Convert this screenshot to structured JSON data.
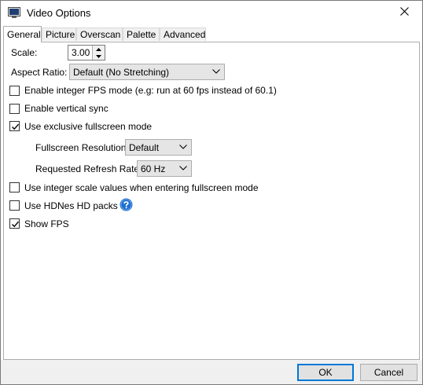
{
  "window": {
    "title": "Video Options",
    "app_icon": "monitor-icon",
    "close_icon": "close-icon"
  },
  "tabs": [
    {
      "label": "General",
      "active": true
    },
    {
      "label": "Picture",
      "active": false
    },
    {
      "label": "Overscan",
      "active": false
    },
    {
      "label": "Palette",
      "active": false
    },
    {
      "label": "Advanced",
      "active": false
    }
  ],
  "general": {
    "scale_label": "Scale:",
    "scale_value": "3.00",
    "aspect_label": "Aspect Ratio:",
    "aspect_value": "Default (No Stretching)",
    "integer_fps": {
      "label": "Enable integer FPS mode (e.g: run at 60 fps instead of 60.1)",
      "checked": false
    },
    "vsync": {
      "label": "Enable vertical sync",
      "checked": false
    },
    "exclusive_fullscreen": {
      "label": "Use exclusive fullscreen mode",
      "checked": true
    },
    "fullscreen_resolution_label": "Fullscreen Resolution:",
    "fullscreen_resolution_value": "Default",
    "refresh_rate_label": "Requested Refresh Rate:",
    "refresh_rate_value": "60 Hz",
    "integer_scale": {
      "label": "Use integer scale values when entering fullscreen mode",
      "checked": false
    },
    "hdpacks": {
      "label": "Use HDNes HD packs",
      "checked": false
    },
    "help_icon": "question-help-icon",
    "show_fps": {
      "label": "Show FPS",
      "checked": true
    }
  },
  "buttons": {
    "ok": "OK",
    "cancel": "Cancel"
  },
  "colors": {
    "accent": "#0078d7",
    "footer": "#f0f0f0",
    "help_icon": "#1e6fd1"
  }
}
